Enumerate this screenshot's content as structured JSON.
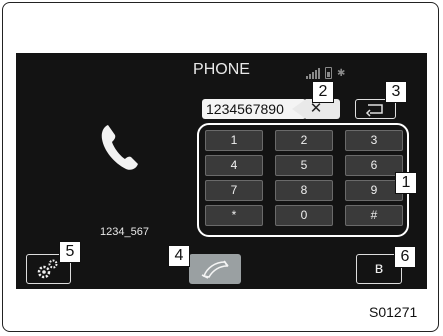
{
  "screen": {
    "title": "PHONE",
    "number_field": "1234567890",
    "caller_id": "1234_567",
    "keypad": [
      "1",
      "2",
      "3",
      "4",
      "5",
      "6",
      "7",
      "8",
      "9",
      "*",
      "0",
      "#"
    ],
    "bluetooth_glyph": "ʙ"
  },
  "callouts": [
    "1",
    "2",
    "3",
    "4",
    "5",
    "6"
  ],
  "figure_code": "S01271",
  "icons": [
    "signal-icon",
    "battery-icon",
    "bluetooth-icon",
    "backspace-icon",
    "swap-icon",
    "handset-icon",
    "settings-icon",
    "call-icon"
  ]
}
